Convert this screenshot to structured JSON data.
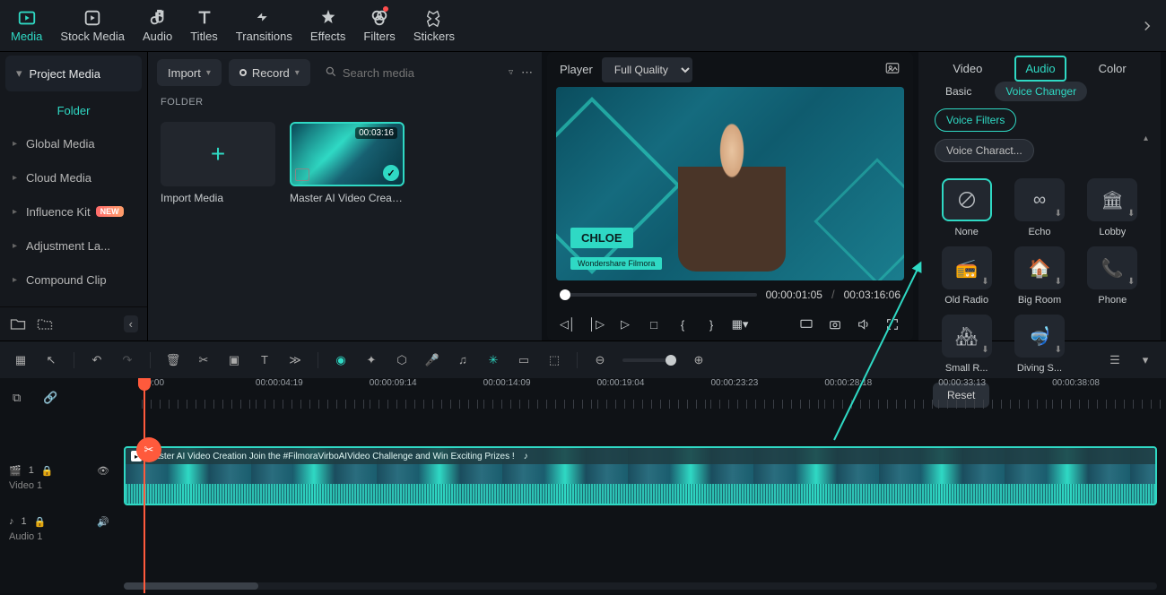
{
  "topTabs": [
    {
      "id": "media",
      "label": "Media"
    },
    {
      "id": "stock",
      "label": "Stock Media"
    },
    {
      "id": "audio",
      "label": "Audio"
    },
    {
      "id": "titles",
      "label": "Titles"
    },
    {
      "id": "transitions",
      "label": "Transitions"
    },
    {
      "id": "effects",
      "label": "Effects"
    },
    {
      "id": "filters",
      "label": "Filters",
      "dot": true
    },
    {
      "id": "stickers",
      "label": "Stickers"
    }
  ],
  "sidebar": {
    "header": "Project Media",
    "folder": "Folder",
    "items": [
      {
        "label": "Global Media"
      },
      {
        "label": "Cloud Media"
      },
      {
        "label": "Influence Kit",
        "badge": "NEW"
      },
      {
        "label": "Adjustment La..."
      },
      {
        "label": "Compound Clip"
      }
    ]
  },
  "mediaBar": {
    "import": "Import",
    "record": "Record",
    "searchPlaceholder": "Search media"
  },
  "folderLabel": "FOLDER",
  "mediaTiles": {
    "importLabel": "Import Media",
    "clip": {
      "duration": "00:03:16",
      "label": "Master AI Video Creati..."
    }
  },
  "preview": {
    "playerLabel": "Player",
    "quality": "Full Quality",
    "nametag": "CHLOE",
    "subtag": "Wondershare Filmora",
    "cur": "00:00:01:05",
    "total": "00:03:16:06"
  },
  "rightPanel": {
    "tabs": [
      "Video",
      "Audio",
      "Color"
    ],
    "subTabs": [
      "Basic",
      "Voice Changer"
    ],
    "pills": [
      "Voice Filters",
      "Voice Charact..."
    ],
    "fx": [
      {
        "label": "None"
      },
      {
        "label": "Echo"
      },
      {
        "label": "Lobby"
      },
      {
        "label": "Old Radio"
      },
      {
        "label": "Big Room"
      },
      {
        "label": "Phone"
      },
      {
        "label": "Small R..."
      },
      {
        "label": "Diving S..."
      }
    ],
    "reset": "Reset"
  },
  "ruler": [
    "00:00",
    "00:00:04:19",
    "00:00:09:14",
    "00:00:14:09",
    "00:00:19:04",
    "00:00:23:23",
    "00:00:28:18",
    "00:00:33:13",
    "00:00:38:08"
  ],
  "tracks": {
    "video": {
      "icon": "🎬",
      "count": "1",
      "name": "Video 1"
    },
    "audio": {
      "icon": "♪",
      "count": "1",
      "name": "Audio 1"
    }
  },
  "clipTitle": "Master AI Video Creation  Join the #FilmoraVirboAIVideo Challenge and Win Exciting Prizes !"
}
